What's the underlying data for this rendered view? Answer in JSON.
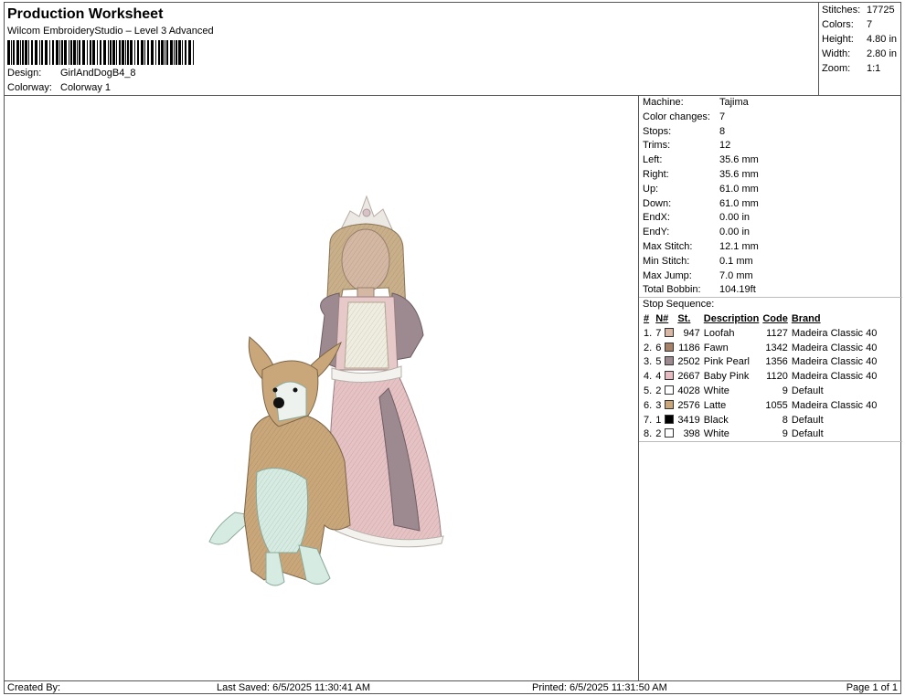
{
  "header": {
    "title": "Production Worksheet",
    "subtitle": "Wilcom EmbroideryStudio – Level 3 Advanced",
    "design_label": "Design:",
    "design_value": "GirlAndDogB4_8",
    "colorway_label": "Colorway:",
    "colorway_value": "Colorway 1"
  },
  "summary": [
    {
      "label": "Stitches:",
      "value": "17725"
    },
    {
      "label": "Colors:",
      "value": "7"
    },
    {
      "label": "Height:",
      "value": "4.80 in"
    },
    {
      "label": "Width:",
      "value": "2.80 in"
    },
    {
      "label": "Zoom:",
      "value": "1:1"
    }
  ],
  "machine_info": [
    {
      "label": "Machine:",
      "value": "Tajima"
    },
    {
      "label": "Color changes:",
      "value": "7"
    },
    {
      "label": "Stops:",
      "value": "8"
    },
    {
      "label": "Trims:",
      "value": "12"
    },
    {
      "label": "Left:",
      "value": "35.6 mm"
    },
    {
      "label": "Right:",
      "value": "35.6 mm"
    },
    {
      "label": "Up:",
      "value": "61.0 mm"
    },
    {
      "label": "Down:",
      "value": "61.0 mm"
    },
    {
      "label": "EndX:",
      "value": "0.00 in"
    },
    {
      "label": "EndY:",
      "value": "0.00 in"
    },
    {
      "label": "Max Stitch:",
      "value": "12.1 mm"
    },
    {
      "label": "Min Stitch:",
      "value": "0.1 mm"
    },
    {
      "label": "Max Jump:",
      "value": "7.0 mm"
    },
    {
      "label": "Total Bobbin:",
      "value": "104.19ft"
    }
  ],
  "stop_sequence": {
    "title": "Stop Sequence:",
    "columns": [
      "#",
      "N#",
      "St.",
      "Description",
      "Code",
      "Brand"
    ],
    "rows": [
      {
        "idx": "1.",
        "n": "7",
        "color": "#d9b7a6",
        "st": "947",
        "desc": "Loofah",
        "code": "1127",
        "brand": "Madeira Classic 40"
      },
      {
        "idx": "2.",
        "n": "6",
        "color": "#a6826a",
        "st": "1186",
        "desc": "Fawn",
        "code": "1342",
        "brand": "Madeira Classic 40"
      },
      {
        "idx": "3.",
        "n": "5",
        "color": "#9c8a90",
        "st": "2502",
        "desc": "Pink Pearl",
        "code": "1356",
        "brand": "Madeira Classic 40"
      },
      {
        "idx": "4.",
        "n": "4",
        "color": "#e6bcc2",
        "st": "2667",
        "desc": "Baby Pink",
        "code": "1120",
        "brand": "Madeira Classic 40"
      },
      {
        "idx": "5.",
        "n": "2",
        "color": "#ffffff",
        "st": "4028",
        "desc": "White",
        "code": "9",
        "brand": "Default"
      },
      {
        "idx": "6.",
        "n": "3",
        "color": "#c9a77a",
        "st": "2576",
        "desc": "Latte",
        "code": "1055",
        "brand": "Madeira Classic 40"
      },
      {
        "idx": "7.",
        "n": "1",
        "color": "#000000",
        "st": "3419",
        "desc": "Black",
        "code": "8",
        "brand": "Default"
      },
      {
        "idx": "8.",
        "n": "2",
        "color": "#ffffff",
        "st": "398",
        "desc": "White",
        "code": "9",
        "brand": "Default"
      }
    ]
  },
  "footer": {
    "created_by": "Created By:",
    "last_saved": "Last Saved: 6/5/2025 11:30:41 AM",
    "printed": "Printed: 6/5/2025 11:31:50 AM",
    "page": "Page 1 of 1"
  }
}
